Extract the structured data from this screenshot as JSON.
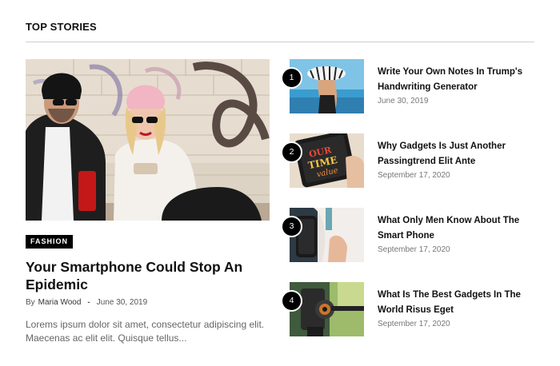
{
  "section": {
    "title": "TOP STORIES"
  },
  "featured": {
    "image_alt": "Couple in sunglasses and beanies sitting by a graffiti wall",
    "category": "FASHION",
    "title": "Your Smartphone Could Stop An Epidemic",
    "by": "By",
    "author": "Maria Wood",
    "separator": "-",
    "date": "June 30, 2019",
    "excerpt": "Lorems ipsum dolor sit amet, consectetur adipiscing elit. Maecenas ac elit elit. Quisque tellus..."
  },
  "stories": [
    {
      "number": "1",
      "title": "Write Your Own Notes In Trump's Handwriting Generator",
      "date": "June 30, 2019"
    },
    {
      "number": "2",
      "title": "Why Gadgets Is Just Another Passingtrend Elit Ante",
      "date": "September 17, 2020"
    },
    {
      "number": "3",
      "title": "What Only Men Know About The Smart Phone",
      "date": "September 17, 2020"
    },
    {
      "number": "4",
      "title": "What Is The Best Gadgets In The World Risus Eget",
      "date": "September 17, 2020"
    }
  ],
  "colors": {
    "text": "#111111",
    "meta": "#777777",
    "badge_bg": "#000000",
    "rule": "#cfcfcf"
  }
}
